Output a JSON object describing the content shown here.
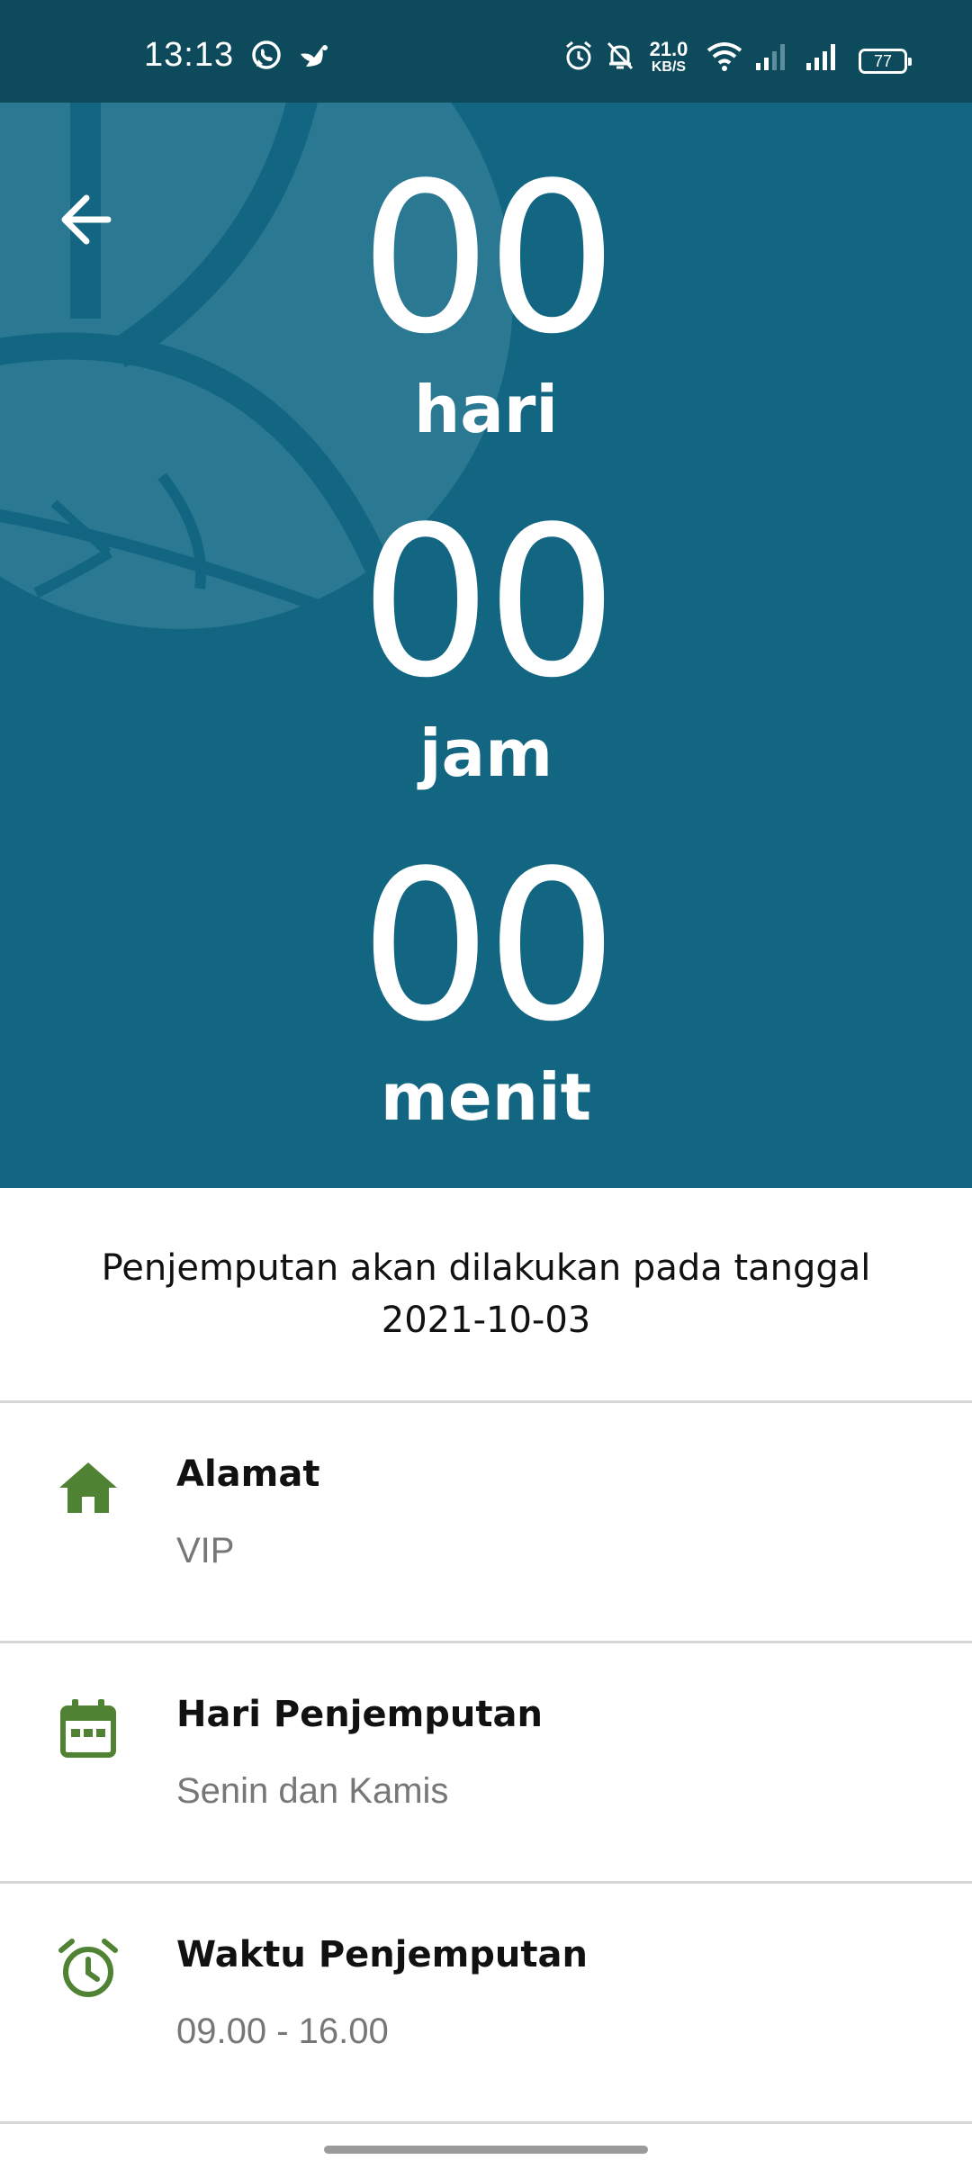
{
  "status_bar": {
    "time": "13:13",
    "net_speed_value": "21.0",
    "net_speed_unit": "KB/S",
    "battery": "77",
    "icons": [
      "whatsapp-icon",
      "bird-icon",
      "alarm-icon",
      "mute-icon",
      "wifi-icon",
      "signal-icon",
      "signal-icon",
      "battery-icon"
    ]
  },
  "countdown": {
    "days_value": "00",
    "days_label": "hari",
    "hours_value": "00",
    "hours_label": "jam",
    "minutes_value": "00",
    "minutes_label": "menit"
  },
  "pickup_notice": {
    "line1": "Penjemputan akan dilakukan pada tanggal",
    "date": "2021-10-03"
  },
  "details": [
    {
      "icon": "home-icon",
      "title": "Alamat",
      "value": "VIP"
    },
    {
      "icon": "calendar-icon",
      "title": "Hari Penjemputan",
      "value": "Senin dan Kamis"
    },
    {
      "icon": "alarm-clock-icon",
      "title": "Waktu Penjemputan",
      "value": "09.00 - 16.00"
    }
  ],
  "colors": {
    "status_bar": "#0d4a5c",
    "header": "#136681",
    "accent_green": "#4f8233",
    "divider": "#d6d6d6"
  }
}
